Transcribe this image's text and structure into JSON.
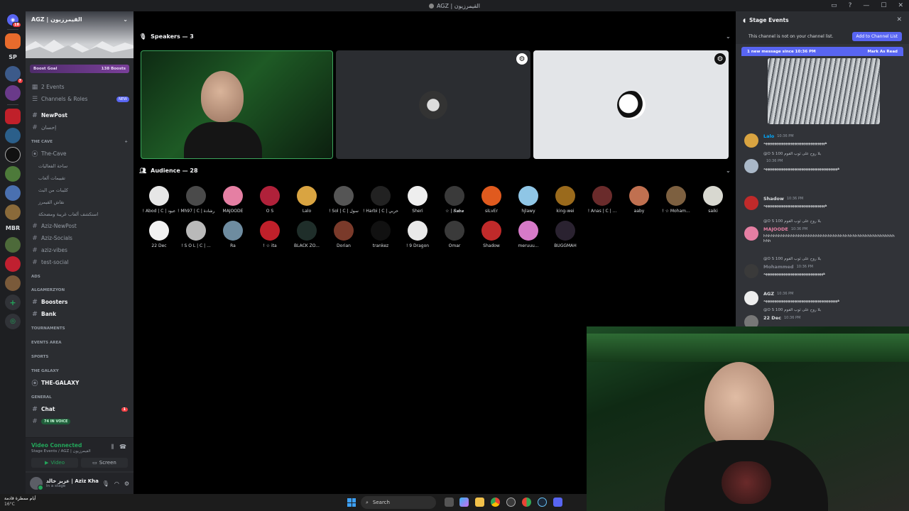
{
  "window": {
    "title": "AGZ | القيمرزيون"
  },
  "rail": {
    "notif_badge": "18",
    "sp_label": "SP",
    "mbr_label": "MBR"
  },
  "server": {
    "name": "AGZ | القيمرزيون",
    "boost_goal": "Boost Goal",
    "boost_count": "138 Boosts"
  },
  "channels": {
    "events": "2 Events",
    "roles": "Channels & Roles",
    "new_badge": "NEW",
    "items": [
      {
        "label": "NewPost",
        "type": "text",
        "bright": true
      },
      {
        "label": "إحسان",
        "type": "text"
      }
    ],
    "cave_category": "THE CAVE",
    "cave_stage": "The-Cave",
    "cave_items": [
      "ساحة الفعاليات",
      "تقييمات ألعاب",
      "كليبات من البث",
      "نقاش القيمرز",
      "استكشف ألعاب غريبة ومضحكة"
    ],
    "aziz_items": [
      "Aziz-NewPost",
      "Aziz-Socials",
      "aziz-vibes",
      "test-social"
    ],
    "ads_category": "ADS",
    "algamer_category": "AlGamerZyon",
    "boosters": "Boosters",
    "bank": "Bank",
    "tournaments": "TOURNAMENTS",
    "events_area": "EVENTS AREA",
    "sports": "SPORTS",
    "galaxy_category": "THE GALAXY",
    "galaxy_channel": "THE-GALAXY",
    "general_category": "GENERAL",
    "chat": "Chat",
    "chat_ping": "1",
    "in_voice": "74 IN VOICE"
  },
  "voice": {
    "status": "Video Connected",
    "location": "Stage Events / AGZ | القيمرزيون",
    "video_btn": "Video",
    "screen_btn": "Screen"
  },
  "user": {
    "name": "عزيز خالد | Aziz Kha...",
    "status": "In a stage"
  },
  "stage": {
    "speakers_header": "Speakers — 3",
    "audience_header": "Audience — 28",
    "audience": [
      {
        "name": "! Abod | C | عبود",
        "color": "#e6e6e6"
      },
      {
        "name": "! Mh97 | C | رشادة",
        "color": "#4a4a4a"
      },
      {
        "name": "MAJOODE",
        "color": "#e57fa3"
      },
      {
        "name": "O S",
        "color": "#b0213a"
      },
      {
        "name": "Lalo",
        "color": "#d9a441"
      },
      {
        "name": "! Sol | C | سول",
        "color": "#555"
      },
      {
        "name": "! Harbi | C | حربي",
        "color": "#222"
      },
      {
        "name": "Sheri",
        "color": "#eee"
      },
      {
        "name": "☆ | 𝑺𝒂𝒃𝒂",
        "color": "#3a3a3a"
      },
      {
        "name": "siLvEr",
        "color": "#e05a1e"
      },
      {
        "name": "hjlawy",
        "color": "#8fc6e6"
      },
      {
        "name": "king-wei",
        "color": "#9a6a1c"
      },
      {
        "name": "! Anas | C | ...",
        "color": "#6a2b2b"
      },
      {
        "name": "aaby",
        "color": "#c07050"
      },
      {
        "name": "! ☆ Moham...",
        "color": "#7d6040"
      },
      {
        "name": "saiki",
        "color": "#d8d8d0"
      },
      {
        "name": "22 Dec",
        "color": "#f2f2f2"
      },
      {
        "name": "! S O L | C | ...",
        "color": "#b9b9b9"
      },
      {
        "name": "Ra",
        "color": "#6e8ca0"
      },
      {
        "name": "! ☆ ita",
        "color": "#c0202a"
      },
      {
        "name": "BLACK ZO...",
        "color": "#1f2e2a"
      },
      {
        "name": "Dorian",
        "color": "#7a3a2a"
      },
      {
        "name": "trankez",
        "color": "#111"
      },
      {
        "name": "! 9 Dragon",
        "color": "#e8e8e8"
      },
      {
        "name": "Omar",
        "color": "#3a3a3a"
      },
      {
        "name": "Shadow",
        "color": "#c02a2a"
      },
      {
        "name": "meruuu...",
        "color": "#d67ac8"
      },
      {
        "name": "BUGGMAH",
        "color": "#2a2230"
      }
    ]
  },
  "chat": {
    "header": "Stage Events",
    "notice": "This channel is not on your channel list.",
    "add_btn": "Add to Channel List",
    "new_msgs": "1 new message since 10:36 PM",
    "mark_read": "Mark As Read",
    "messages": [
      {
        "name": "Lalo",
        "name_color": "#00a8fc",
        "time": "10:36 PM",
        "reply": "",
        "body": "ههههههههههههههههههههههههههههههههههه"
      },
      {
        "name": "",
        "name_color": "#dbdee1",
        "time": "10:36 PM",
        "reply": "@O S 100 بلا روح على ثوب القوم",
        "body": "هههههههههههههههههههههههههههههههههههههههههه"
      },
      {
        "name": "Shadow",
        "name_color": "#dbdee1",
        "time": "10:36 PM",
        "reply": "",
        "body": "ههههههههههههههههههههههههههههههههههه"
      },
      {
        "name": "MAJOODE",
        "name_color": "#e57fa3",
        "time": "10:36 PM",
        "reply": "@O S 100 بلا روح على ثوب القوم",
        "body": "hhhhhhhhhhhhhhhhhhhhhhhhhhhhhhhhhhhhhhhhhhhhhhhhhhhhhhhh"
      },
      {
        "name": "Mohammed",
        "name_color": "#80848e",
        "time": "10:36 PM",
        "reply": "@O S 100 بلا روح على ثوب القوم",
        "body": "هههههههههههههههههههههههههههههههههه"
      },
      {
        "name": "AGZ",
        "name_color": "#dbdee1",
        "time": "10:36 PM",
        "reply": "",
        "body": "هههههههههههههههههههههههههههههههههههههههههه"
      },
      {
        "name": "22 Dec",
        "name_color": "#dbdee1",
        "time": "10:36 PM",
        "reply": "@O S 100 بلا روح على ثوب القوم",
        "body": ""
      }
    ]
  },
  "taskbar": {
    "weather_text": "أيام ممطرة قادمة",
    "temp": "16°C",
    "search": "Search"
  }
}
